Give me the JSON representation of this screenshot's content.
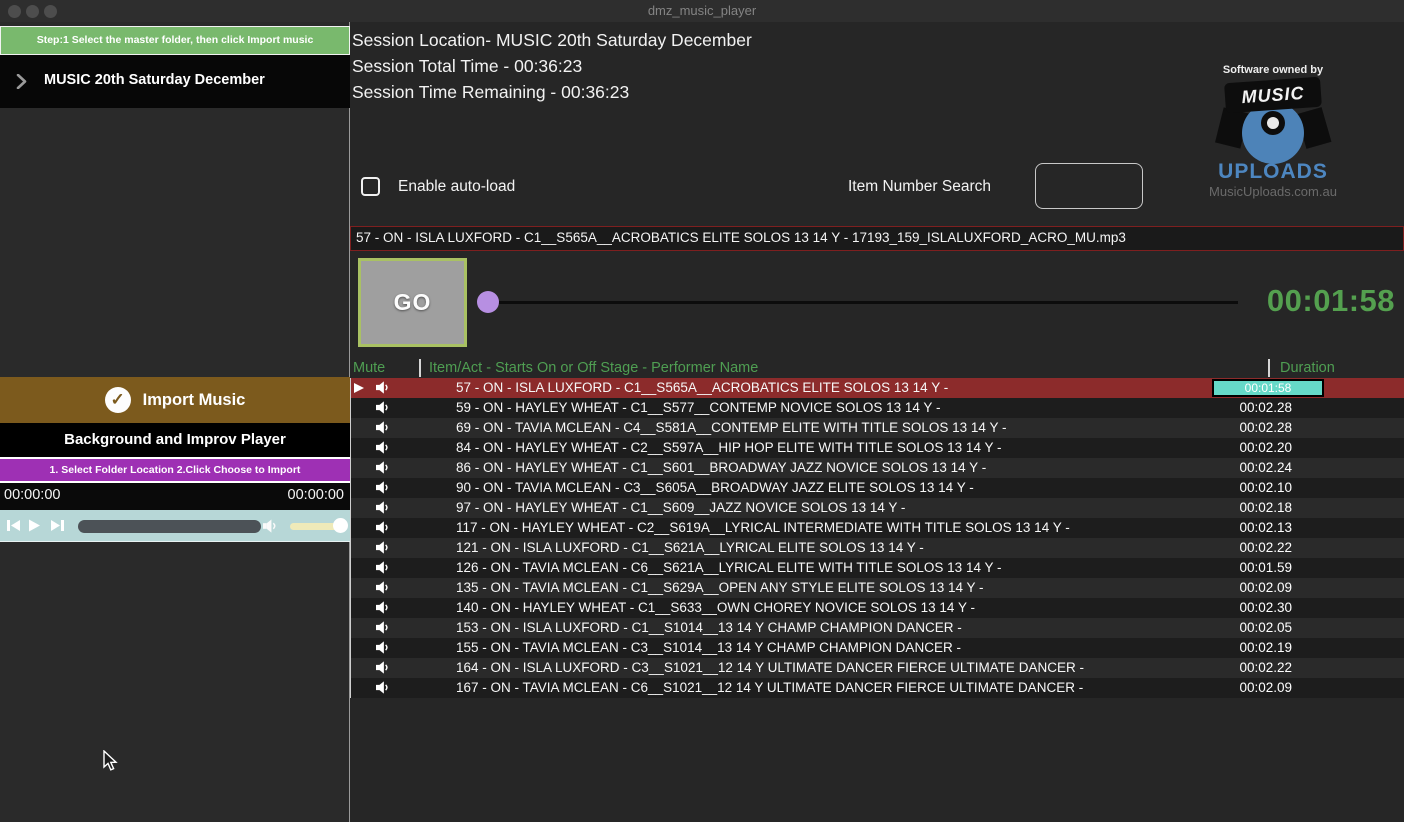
{
  "window": {
    "title": "dmz_music_player"
  },
  "sidebar": {
    "step_banner": "Step:1 Select the master folder, then click Import music",
    "folder_item": "MUSIC 20th Saturday December",
    "import_button": "Import Music",
    "player_title": "Background and Improv Player",
    "import_banner": "1. Select Folder Location 2.Click Choose to Import",
    "time_elapsed": "00:00:00",
    "time_total": "00:00:00"
  },
  "session": {
    "location": "Session Location- MUSIC 20th Saturday December",
    "total_time": "Session Total Time - 00:36:23",
    "time_remaining": "Session Time Remaining - 00:36:23"
  },
  "branding": {
    "owned_by": "Software owned by",
    "logo_top": "MUSIC",
    "logo_bottom": "UPLOADS",
    "website": "MusicUploads.com.au"
  },
  "controls": {
    "autoload_label": "Enable auto-load",
    "search_label": "Item Number Search",
    "search_value": "",
    "go_label": "GO",
    "current_track_time": "00:01:58"
  },
  "now_playing": "57 - ON - ISLA LUXFORD - C1__S565A__ACROBATICS ELITE SOLOS 13 14 Y - 17193_159_ISLALUXFORD_ACRO_MU.mp3",
  "table": {
    "headers": {
      "mute": "Mute",
      "item": "Item/Act - Starts On or Off Stage - Performer Name",
      "duration": "Duration",
      "pipe": "|"
    },
    "rows": [
      {
        "text": "57 - ON - ISLA LUXFORD - C1__S565A__ACROBATICS ELITE SOLOS 13 14 Y -",
        "duration": "00:01:58",
        "current": true
      },
      {
        "text": "59 - ON - HAYLEY WHEAT - C1__S577__CONTEMP NOVICE SOLOS 13 14 Y -",
        "duration": "00:02.28",
        "current": false
      },
      {
        "text": "69 - ON - TAVIA MCLEAN - C4__S581A__CONTEMP ELITE WITH TITLE SOLOS 13 14 Y -",
        "duration": "00:02.28",
        "current": false
      },
      {
        "text": "84 - ON - HAYLEY WHEAT - C2__S597A__HIP HOP ELITE WITH TITLE SOLOS 13 14 Y -",
        "duration": "00:02.20",
        "current": false
      },
      {
        "text": "86 - ON - HAYLEY WHEAT - C1__S601__BROADWAY JAZZ NOVICE SOLOS 13 14 Y -",
        "duration": "00:02.24",
        "current": false
      },
      {
        "text": "90 - ON - TAVIA MCLEAN - C3__S605A__BROADWAY JAZZ ELITE SOLOS 13 14 Y -",
        "duration": "00:02.10",
        "current": false
      },
      {
        "text": "97 - ON - HAYLEY WHEAT - C1__S609__JAZZ NOVICE SOLOS 13 14 Y -",
        "duration": "00:02.18",
        "current": false
      },
      {
        "text": "117 - ON - HAYLEY WHEAT - C2__S619A__LYRICAL INTERMEDIATE WITH TITLE SOLOS 13 14 Y -",
        "duration": "00:02.13",
        "current": false
      },
      {
        "text": "121 - ON - ISLA LUXFORD - C1__S621A__LYRICAL ELITE SOLOS 13 14 Y -",
        "duration": "00:02.22",
        "current": false
      },
      {
        "text": "126 - ON - TAVIA MCLEAN - C6__S621A__LYRICAL ELITE WITH TITLE SOLOS 13 14 Y -",
        "duration": "00:01.59",
        "current": false
      },
      {
        "text": "135 - ON - TAVIA MCLEAN - C1__S629A__OPEN ANY STYLE ELITE SOLOS 13 14 Y -",
        "duration": "00:02.09",
        "current": false
      },
      {
        "text": "140 - ON - HAYLEY WHEAT - C1__S633__OWN CHOREY NOVICE SOLOS 13 14 Y -",
        "duration": "00:02.30",
        "current": false
      },
      {
        "text": "153 - ON - ISLA LUXFORD - C1__S1014__13 14 Y CHAMP CHAMPION DANCER -",
        "duration": "00:02.05",
        "current": false
      },
      {
        "text": "155 - ON - TAVIA MCLEAN - C3__S1014__13 14 Y CHAMP CHAMPION DANCER -",
        "duration": "00:02.19",
        "current": false
      },
      {
        "text": "164 - ON - ISLA LUXFORD - C3__S1021__12 14 Y ULTIMATE DANCER FIERCE ULTIMATE DANCER -",
        "duration": "00:02.22",
        "current": false
      },
      {
        "text": "167 - ON - TAVIA MCLEAN - C6__S1021__12 14 Y ULTIMATE DANCER FIERCE ULTIMATE DANCER -",
        "duration": "00:02.09",
        "current": false
      }
    ]
  },
  "colors": {
    "accent_green": "#4f9e52",
    "time_green": "#54a04f",
    "current_row_red": "#8c2b2b",
    "badge_teal": "#66d9c8",
    "purple_banner": "#9e30b4",
    "import_brown": "#7c5a1d",
    "step_green": "#79b96d",
    "player_bar_blue": "#b7d7d7",
    "seek_thumb_purple": "#b78fe2"
  }
}
